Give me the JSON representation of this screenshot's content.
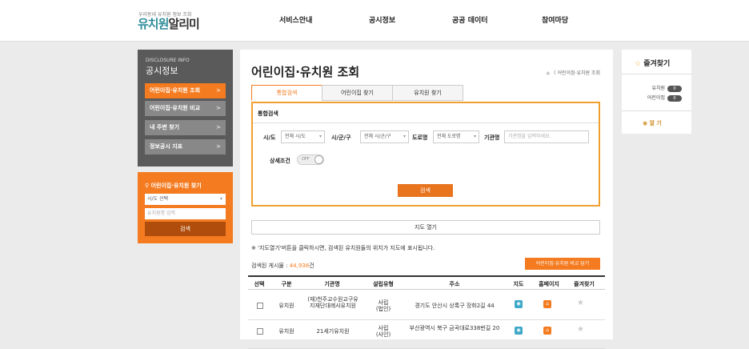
{
  "header": {
    "logo_sub": "우리동네 유치원 정보 조회",
    "logo_main_1": "유치원",
    "logo_main_2": "알리미",
    "nav": [
      "서비스안내",
      "공시정보",
      "공공 데이터",
      "참여마당"
    ]
  },
  "sidebar": {
    "eng_title": "DISCLOSURE INFO",
    "title": "공시정보",
    "items": [
      {
        "label": "어린이집·유치원 조회",
        "active": true
      },
      {
        "label": "어린이집·유치원 비교",
        "active": false
      },
      {
        "label": "내 주변 찾기",
        "active": false
      },
      {
        "label": "정보공시 지표",
        "active": false
      }
    ],
    "arrow": ">"
  },
  "finder": {
    "title": "어린이집·유치원 찾기",
    "select_value": "시/도 선택",
    "input_placeholder": "유치원명 입력",
    "button": "검색"
  },
  "main": {
    "title": "어린이집·유치원 조회",
    "breadcrumb": "⌂ 〈 어린이집·유치원 조회",
    "tabs": [
      "통합검색",
      "어린이집 찾기",
      "유치원 찾기"
    ],
    "search": {
      "box_title": "통합검색",
      "sido_label": "시/도",
      "sido_value": "전체 시/도",
      "sigungu_label": "시/군/구",
      "sigungu_value": "전체 시/군/구",
      "road_label": "도로명",
      "road_value": "전체 도로명",
      "org_label": "기관명",
      "org_placeholder": "기관명을 입력하세요.",
      "detail_label": "상세조건",
      "toggle_value": "OFF",
      "button": "검색"
    },
    "map_button": "지도 열기",
    "note": "※ '지도열기'버튼을 클릭하시면, 검색된 유치원들의 위치가 지도에 표시됩니다.",
    "count_prefix": "검색된 게시물 : ",
    "count_value": "44,938",
    "count_suffix": "건",
    "compare_button": "어린이집·유치원 비교 담기",
    "table": {
      "headers": [
        "선택",
        "구분",
        "기관명",
        "설립유형",
        "주소",
        "지도",
        "홈페이지",
        "즐겨찾기"
      ],
      "rows": [
        {
          "type": "유치원",
          "name": "(재)천주교수원교구유지재단대례사유치원",
          "estab": "사립\n(법인)",
          "addr": "경기도 안산시 상록구 장화2길 44"
        },
        {
          "type": "유치원",
          "name": "21세기유치원",
          "estab": "사립\n(사인)",
          "addr": "부산광역시 북구 금곡대로338번길 20"
        }
      ]
    }
  },
  "favorites": {
    "title": "즐겨찾기",
    "rows": [
      {
        "label": "유치원",
        "count": "0"
      },
      {
        "label": "어린이집",
        "count": "0"
      }
    ],
    "open_label": "열 기"
  }
}
